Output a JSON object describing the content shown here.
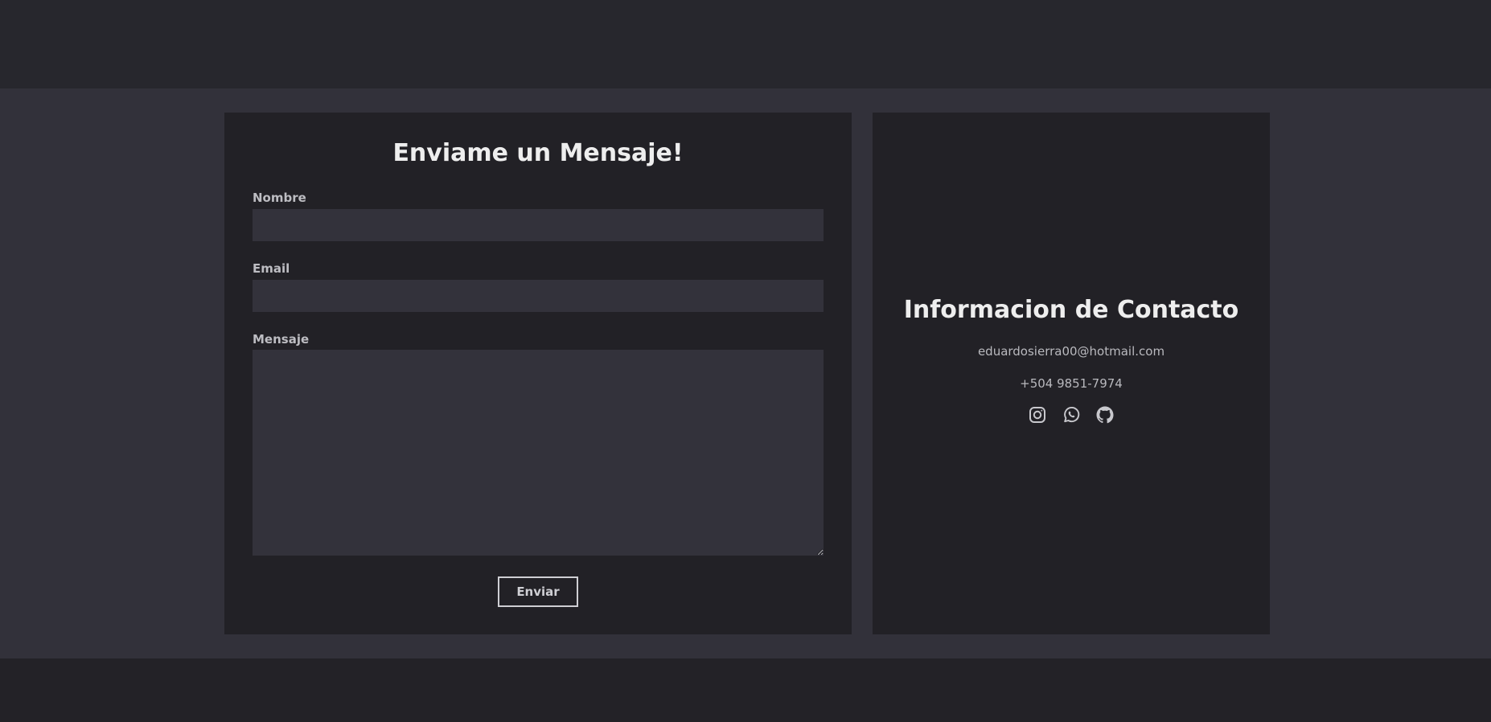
{
  "form": {
    "title": "Enviame un Mensaje!",
    "fields": {
      "name_label": "Nombre",
      "name_value": "",
      "email_label": "Email",
      "email_value": "",
      "message_label": "Mensaje",
      "message_value": ""
    },
    "submit_label": "Enviar"
  },
  "contact": {
    "title": "Informacion de Contacto",
    "email": "eduardosierra00@hotmail.com",
    "phone": "+504 9851-7974",
    "socials": [
      {
        "icon": "instagram-icon"
      },
      {
        "icon": "whatsapp-icon"
      },
      {
        "icon": "github-icon"
      }
    ]
  },
  "colors": {
    "page_bg": "#232227",
    "header_bg": "#27272d",
    "section_bg": "#32313a",
    "card_bg": "#222126",
    "input_bg": "#33323b",
    "text_primary": "#eeeeee",
    "text_secondary": "#b9b9be"
  }
}
